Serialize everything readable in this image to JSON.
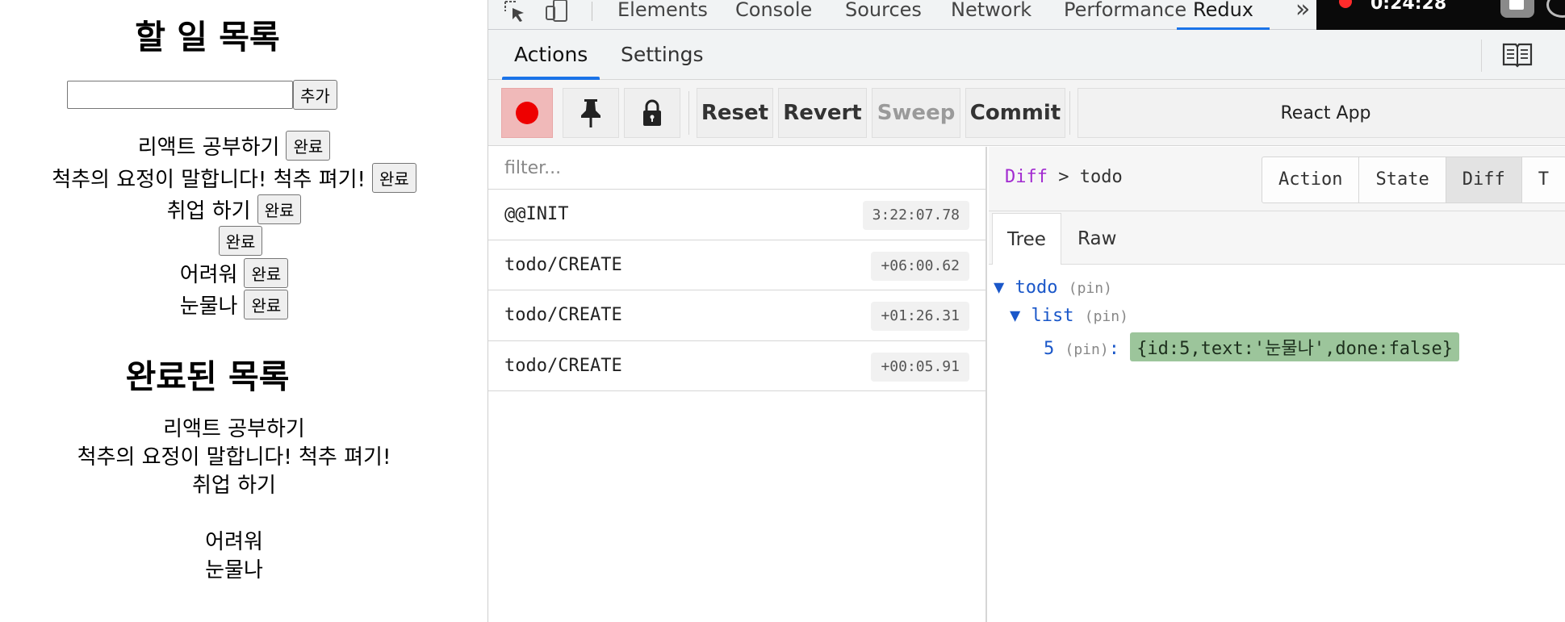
{
  "app": {
    "title": "할 일 목록",
    "add_input_value": "",
    "add_button": "추가",
    "todos": [
      {
        "text": "리액트 공부하기",
        "button": "완료"
      },
      {
        "text": "척추의 요정이 말합니다! 척추 펴기!",
        "button": "완료"
      },
      {
        "text": "취업 하기",
        "button": "완료"
      },
      {
        "text": "",
        "button": "완료"
      },
      {
        "text": "어려워",
        "button": "완료"
      },
      {
        "text": "눈물나",
        "button": "완료"
      }
    ],
    "done_title": "완료된 목록",
    "done_items": [
      "리액트 공부하기",
      "척추의 요정이 말합니다! 척추 펴기!",
      "취업 하기",
      "",
      "어려워",
      "눈물나"
    ]
  },
  "devtools": {
    "tabs": [
      "Elements",
      "Console",
      "Sources",
      "Network",
      "Performance",
      "Redux"
    ],
    "active_tab": "Redux",
    "more": "»",
    "recording_time": "0:24:28",
    "sub_tabs": [
      "Actions",
      "Settings"
    ],
    "active_sub_tab": "Actions",
    "toolbar": {
      "reset": "Reset",
      "revert": "Revert",
      "sweep": "Sweep",
      "commit": "Commit",
      "instance": "React App"
    },
    "filter_placeholder": "filter...",
    "actions": [
      {
        "name": "@@INIT",
        "time": "3:22:07.78"
      },
      {
        "name": "todo/CREATE",
        "time": "+06:00.62"
      },
      {
        "name": "todo/CREATE",
        "time": "+01:26.31"
      },
      {
        "name": "todo/CREATE",
        "time": "+00:05.91"
      }
    ],
    "breadcrumb_root": "Diff",
    "breadcrumb_sep": ">",
    "breadcrumb_leaf": "todo",
    "modes": [
      "Action",
      "State",
      "Diff",
      "T"
    ],
    "active_mode": "Diff",
    "views": [
      "Tree",
      "Raw"
    ],
    "active_view": "Tree",
    "tree": {
      "arrow": "▼",
      "root_key": "todo",
      "pin": "(pin)",
      "child_key": "list",
      "item_key": "5",
      "colon": ":",
      "item_value": "{id:5,text:'눈물나',done:false}"
    }
  }
}
